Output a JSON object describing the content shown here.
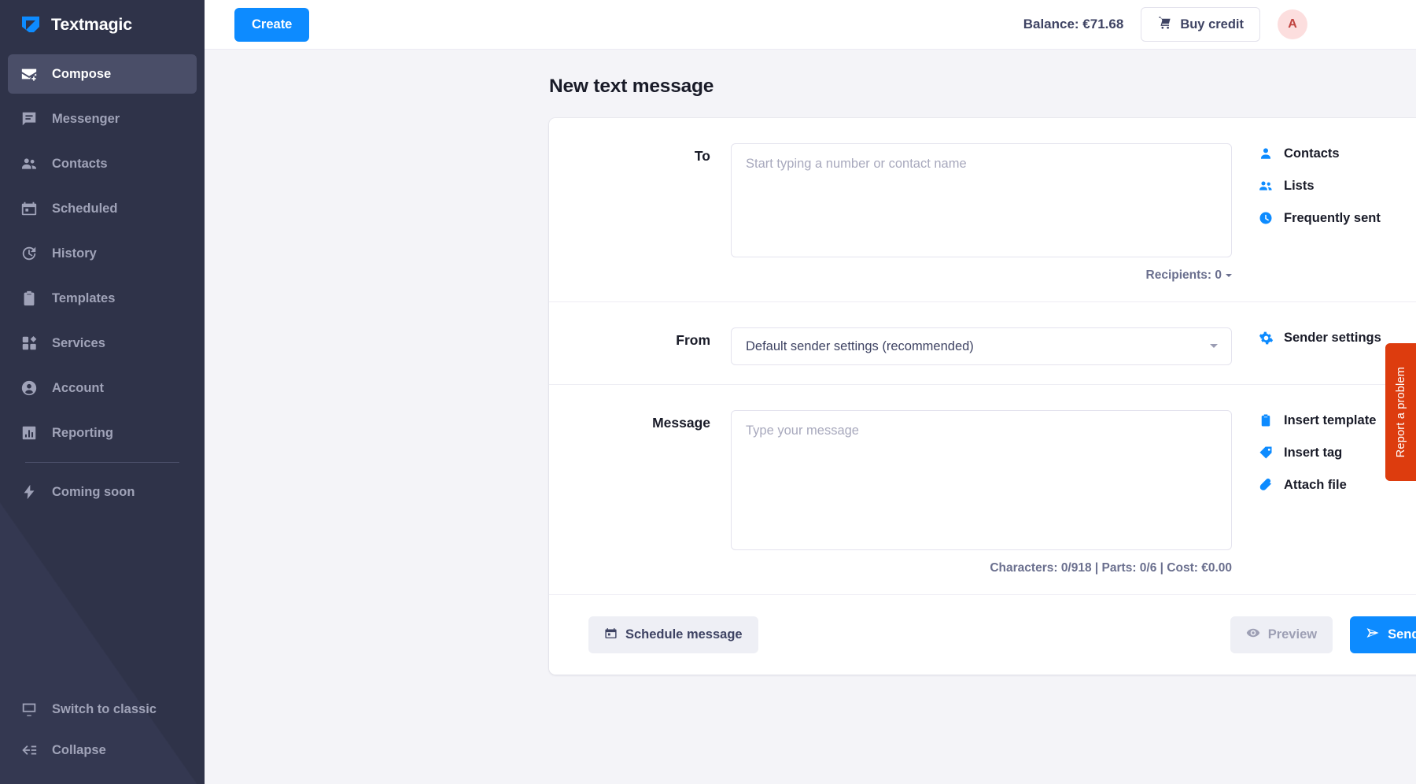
{
  "brand": {
    "name": "Textmagic",
    "logo_icon": "textmagic-logo-icon"
  },
  "sidebar": {
    "items": [
      {
        "label": "Compose",
        "icon": "compose-mail-icon",
        "active": true
      },
      {
        "label": "Messenger",
        "icon": "chat-bubble-icon",
        "active": false
      },
      {
        "label": "Contacts",
        "icon": "contacts-icon",
        "active": false
      },
      {
        "label": "Scheduled",
        "icon": "calendar-icon",
        "active": false
      },
      {
        "label": "History",
        "icon": "history-clock-icon",
        "active": false
      },
      {
        "label": "Templates",
        "icon": "clipboard-icon",
        "active": false
      },
      {
        "label": "Services",
        "icon": "services-grid-icon",
        "active": false
      },
      {
        "label": "Account",
        "icon": "user-circle-icon",
        "active": false
      },
      {
        "label": "Reporting",
        "icon": "bar-chart-icon",
        "active": false
      }
    ],
    "after_divider": [
      {
        "label": "Coming soon",
        "icon": "lightning-bolt-icon"
      }
    ],
    "bottom": [
      {
        "label": "Switch to classic",
        "icon": "switch-screen-icon"
      },
      {
        "label": "Collapse",
        "icon": "collapse-arrow-icon"
      }
    ]
  },
  "topbar": {
    "create_label": "Create",
    "balance_label": "Balance: €71.68",
    "buy_credit_label": "Buy credit",
    "buy_credit_icon": "shopping-cart-icon",
    "avatar_initial": "A"
  },
  "page": {
    "title": "New text message"
  },
  "form": {
    "to": {
      "label": "To",
      "value": "",
      "placeholder": "Start typing a number or contact name",
      "meta": "Recipients: 0",
      "links": [
        {
          "label": "Contacts",
          "icon": "contact-person-icon"
        },
        {
          "label": "Lists",
          "icon": "contact-list-icon"
        },
        {
          "label": "Frequently sent",
          "icon": "clock-icon"
        }
      ]
    },
    "from": {
      "label": "From",
      "selected": "Default sender settings (recommended)",
      "options": [
        "Default sender settings (recommended)"
      ],
      "links": [
        {
          "label": "Sender settings",
          "icon": "gear-icon"
        }
      ]
    },
    "message": {
      "label": "Message",
      "value": "",
      "placeholder": "Type your message",
      "meta": "Characters: 0/918 | Parts: 0/6 | Cost: €0.00",
      "links": [
        {
          "label": "Insert template",
          "icon": "template-clipboard-icon"
        },
        {
          "label": "Insert tag",
          "icon": "tag-icon"
        },
        {
          "label": "Attach file",
          "icon": "paperclip-icon"
        }
      ]
    }
  },
  "actions": {
    "schedule_label": "Schedule message",
    "schedule_icon": "calendar-icon",
    "preview_label": "Preview",
    "preview_icon": "eye-icon",
    "send_label": "Send now",
    "send_icon": "paper-plane-icon"
  },
  "report_tab": {
    "label": "Report a problem"
  },
  "colors": {
    "accent": "#0d8bff",
    "sidebar_bg": "#2f3349",
    "sidebar_active": "#4a4e68",
    "page_bg": "#f4f4f8",
    "report_tab": "#dd3c0e",
    "avatar_bg": "#fcdede",
    "avatar_fg": "#c0433f"
  }
}
